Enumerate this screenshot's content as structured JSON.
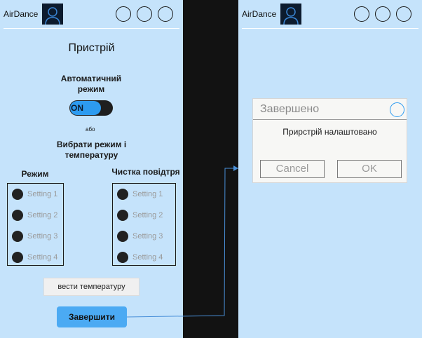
{
  "screens": {
    "left": {
      "header": {
        "brand": "AirDance",
        "avatar_icon": "user-avatar-icon"
      },
      "title": "Пристрій",
      "auto_mode_label": "Автоматичний режим",
      "toggle_text": "ON",
      "or_text": "або",
      "choose_label": "Вибрати режим і температуру",
      "mode_group": {
        "title": "Режим",
        "options": [
          "Setting 1",
          "Setting 2",
          "Setting 3",
          "Setting 4"
        ]
      },
      "clean_group": {
        "title": "Чистка повідтря",
        "options": [
          "Setting 1",
          "Setting 2",
          "Setting 3",
          "Setting 4"
        ]
      },
      "temp_button": "вести температуру",
      "finish_button": "Завершити"
    },
    "right": {
      "header": {
        "brand": "AirDance",
        "avatar_icon": "user-avatar-icon"
      },
      "dialog": {
        "title": "Завершено",
        "message": "Прирстрій налаштовано",
        "cancel": "Cancel",
        "ok": "OK"
      }
    }
  },
  "colors": {
    "screen_bg": "#c5e3fb",
    "gap_bg": "#121212",
    "accent": "#2d9bf0",
    "finish_button": "#4baaf3"
  }
}
